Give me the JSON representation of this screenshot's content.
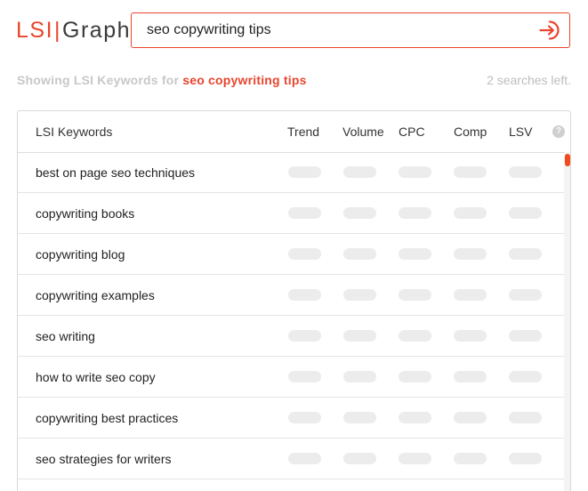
{
  "logo": {
    "part1": "LSI",
    "separator": "|",
    "part2": "Graph"
  },
  "search": {
    "value": "seo copywriting tips",
    "placeholder": ""
  },
  "status": {
    "prefix": "Showing LSI Keywords for ",
    "query": "seo copywriting tips",
    "searches_left": "2 searches left."
  },
  "table": {
    "headers": {
      "keyword": "LSI Keywords",
      "trend": "Trend",
      "volume": "Volume",
      "cpc": "CPC",
      "comp": "Comp",
      "lsv": "LSV",
      "help": "?"
    },
    "rows": [
      "best on page seo techniques",
      "copywriting books",
      "copywriting blog",
      "copywriting examples",
      "seo writing",
      "how to write seo copy",
      "copywriting best practices",
      "seo strategies for writers"
    ]
  },
  "colors": {
    "accent": "#e8452c",
    "scroll_thumb": "#f24a1d",
    "placeholder_pill": "#ececec"
  },
  "icons": {
    "search_submit": "sign-in-arrow-icon",
    "help": "question-circle-icon"
  }
}
